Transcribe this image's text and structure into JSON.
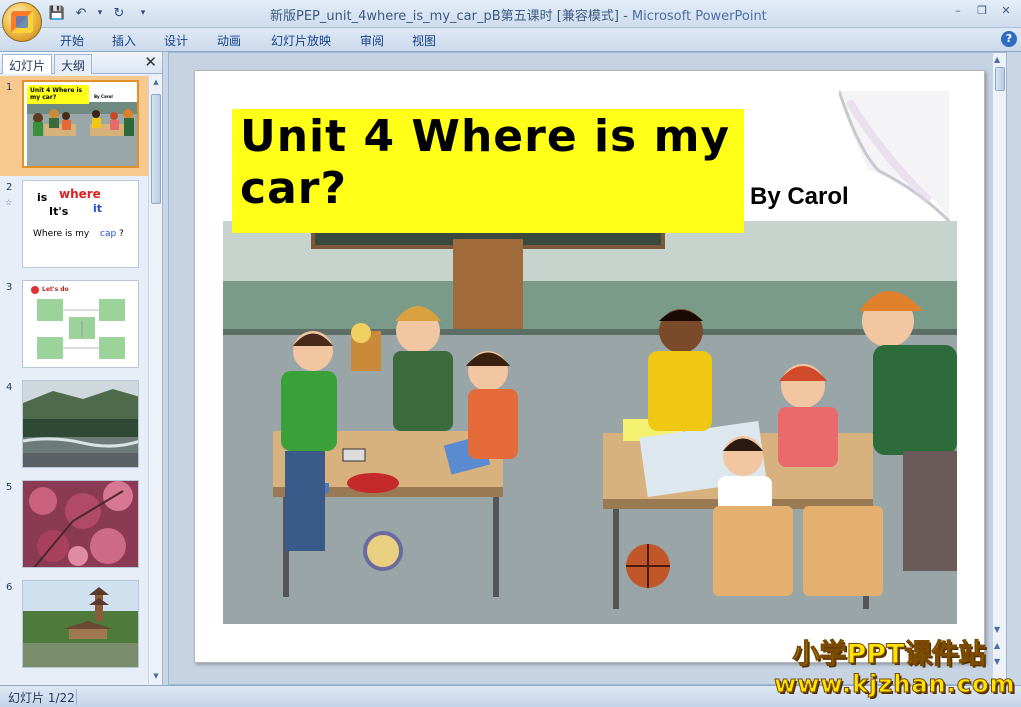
{
  "window": {
    "title": "新版PEP_unit_4where_is_my_car_pB第五课时 [兼容模式]",
    "title_sep": " - ",
    "app_name": "Microsoft PowerPoint",
    "help": "?"
  },
  "qat": {
    "save": "💾",
    "undo": "↶",
    "undo_drop": "▾",
    "redo": "↻",
    "customize": "▾"
  },
  "window_controls": {
    "minimize": "–",
    "restore": "❐",
    "close": "✕"
  },
  "ribbon": {
    "tabs": [
      "开始",
      "插入",
      "设计",
      "动画",
      "幻灯片放映",
      "审阅",
      "视图"
    ]
  },
  "left_pane": {
    "tabs": [
      "幻灯片",
      "大纲"
    ],
    "close": "✕",
    "thumbnails": [
      {
        "num": "1",
        "title_mini": "Unit 4 Where is my car?",
        "by_mini": "By Carol"
      },
      {
        "num": "2",
        "star": "☆",
        "line1a": "is",
        "line1b": "where",
        "line2a": "It's",
        "line2b": "it",
        "line3a": "Where is my",
        "line3b": "cap",
        "line3c": "?"
      },
      {
        "num": "3",
        "label": "Let's do"
      },
      {
        "num": "4"
      },
      {
        "num": "5"
      },
      {
        "num": "6"
      }
    ]
  },
  "slide": {
    "title": "Unit 4 Where is my car?",
    "byline": "By Carol"
  },
  "status": {
    "slide_counter": "幻灯片 1/22"
  },
  "watermark": {
    "line1": "小学PPT课件站",
    "line2": "www.kjzhan.com"
  },
  "colors": {
    "title_box": "#ffff17",
    "ribbon_bg": "#dfe9f5",
    "selected_thumb": "#f7c98e"
  }
}
